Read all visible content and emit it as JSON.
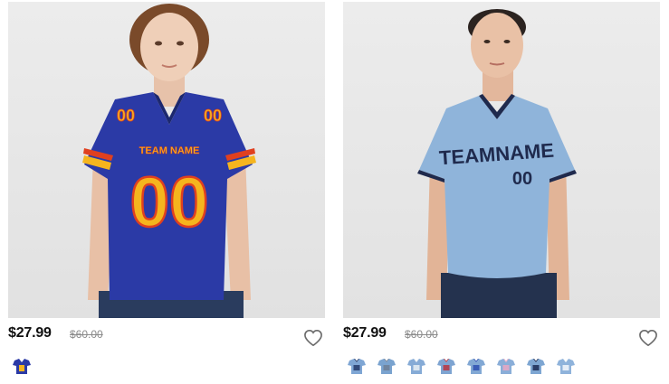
{
  "products": [
    {
      "price": "$27.99",
      "old_price": "$60.00",
      "image": {
        "alt": "Royal blue football jersey with gold numbers, TEAM NAME 00"
      },
      "jersey": {
        "team_text": "TEAM NAME",
        "number": "00",
        "body_color": "#2b3aa6",
        "accent_color": "#f5b51e",
        "trim_color": "#e0401f"
      },
      "swatches": [
        {
          "name": "royal-gold-swatch",
          "primary": "#2b3aa6",
          "secondary": "#f5b51e"
        }
      ]
    },
    {
      "price": "$27.99",
      "old_price": "$60.00",
      "image": {
        "alt": "Light blue V-neck baseball jersey with navy lettering, TEAMNAME 00"
      },
      "jersey": {
        "team_text": "TEAMNAME",
        "number": "00",
        "body_color": "#8fb4da",
        "accent_color": "#1f2a4d"
      },
      "swatches": [
        {
          "name": "light-blue-navy-swatch",
          "primary": "#7fa6d4",
          "secondary": "#243a6a"
        },
        {
          "name": "light-blue-gray-swatch",
          "primary": "#7aa3cf",
          "secondary": "#6f7f95"
        },
        {
          "name": "light-blue-white-swatch",
          "primary": "#86abd6",
          "secondary": "#e8eef5"
        },
        {
          "name": "light-blue-red-swatch",
          "primary": "#7ea4d1",
          "secondary": "#b8353f"
        },
        {
          "name": "light-blue-royal-swatch",
          "primary": "#82a8d4",
          "secondary": "#2e4fb0"
        },
        {
          "name": "light-blue-pink-swatch",
          "primary": "#8aaed8",
          "secondary": "#e7a7c3"
        },
        {
          "name": "light-blue-navy-2-swatch",
          "primary": "#7ea6d2",
          "secondary": "#1b2a55"
        },
        {
          "name": "light-blue-white-2-swatch",
          "primary": "#8fb3db",
          "secondary": "#f4f7fb"
        }
      ]
    }
  ]
}
